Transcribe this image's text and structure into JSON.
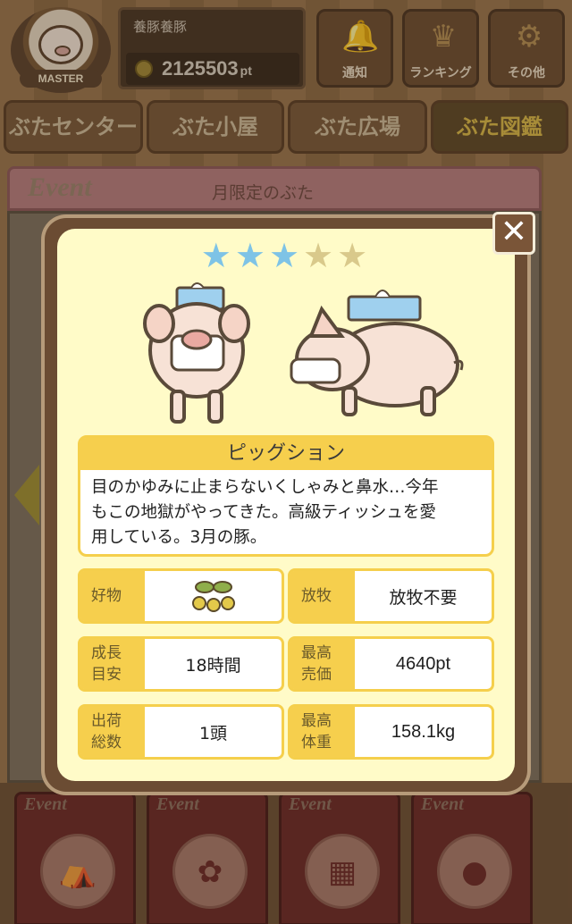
{
  "header": {
    "master_label": "MASTER",
    "user_name": "養豚養豚",
    "points": "2125503",
    "points_unit": "pt",
    "buttons": [
      {
        "label": "通知",
        "icon": "bell-icon"
      },
      {
        "label": "ランキング",
        "icon": "crown-icon"
      },
      {
        "label": "その他",
        "icon": "gear-icon"
      }
    ]
  },
  "nav": {
    "tabs": [
      {
        "label": "ぶたセンター"
      },
      {
        "label": "ぶた小屋"
      },
      {
        "label": "ぶた広場"
      },
      {
        "label": "ぶた図鑑",
        "active": true
      }
    ]
  },
  "event": {
    "tag": "Event",
    "title": "月限定のぶた"
  },
  "bottom": {
    "cards": [
      {
        "tag": "Event",
        "icon": "circus-tent-icon"
      },
      {
        "tag": "Event",
        "icon": "pig-wreath-icon"
      },
      {
        "tag": "Event",
        "icon": "calendar-icon"
      },
      {
        "tag": "Event",
        "icon": "pigs-icon"
      }
    ]
  },
  "modal": {
    "close_label": "✕",
    "rating": 3,
    "rating_max": 5,
    "name": "ピッグション",
    "description_lines": [
      "目のかゆみに止まらないくしゃみと鼻水…今年",
      "もこの地獄がやってきた。高級ティッシュを愛",
      "用している。3月の豚。"
    ],
    "stats": {
      "favorite": {
        "key": "好物",
        "value_icon": "soybeans-icon"
      },
      "grazing": {
        "key": "放牧",
        "value": "放牧不要"
      },
      "growth": {
        "key_line1": "成長",
        "key_line2": "目安",
        "value": "18時間"
      },
      "max_price": {
        "key_line1": "最高",
        "key_line2": "売価",
        "value": "4640pt"
      },
      "shipped": {
        "key_line1": "出荷",
        "key_line2": "総数",
        "value": "1頭"
      },
      "max_weight": {
        "key_line1": "最高",
        "key_line2": "体重",
        "value": "158.1kg"
      }
    }
  },
  "colors": {
    "modal_bg": "#fffbc8",
    "accent_yellow": "#f6cf4d",
    "star_on": "#7ec3e6",
    "star_off": "#d9c98b",
    "frame_brown": "#6b4c33"
  }
}
